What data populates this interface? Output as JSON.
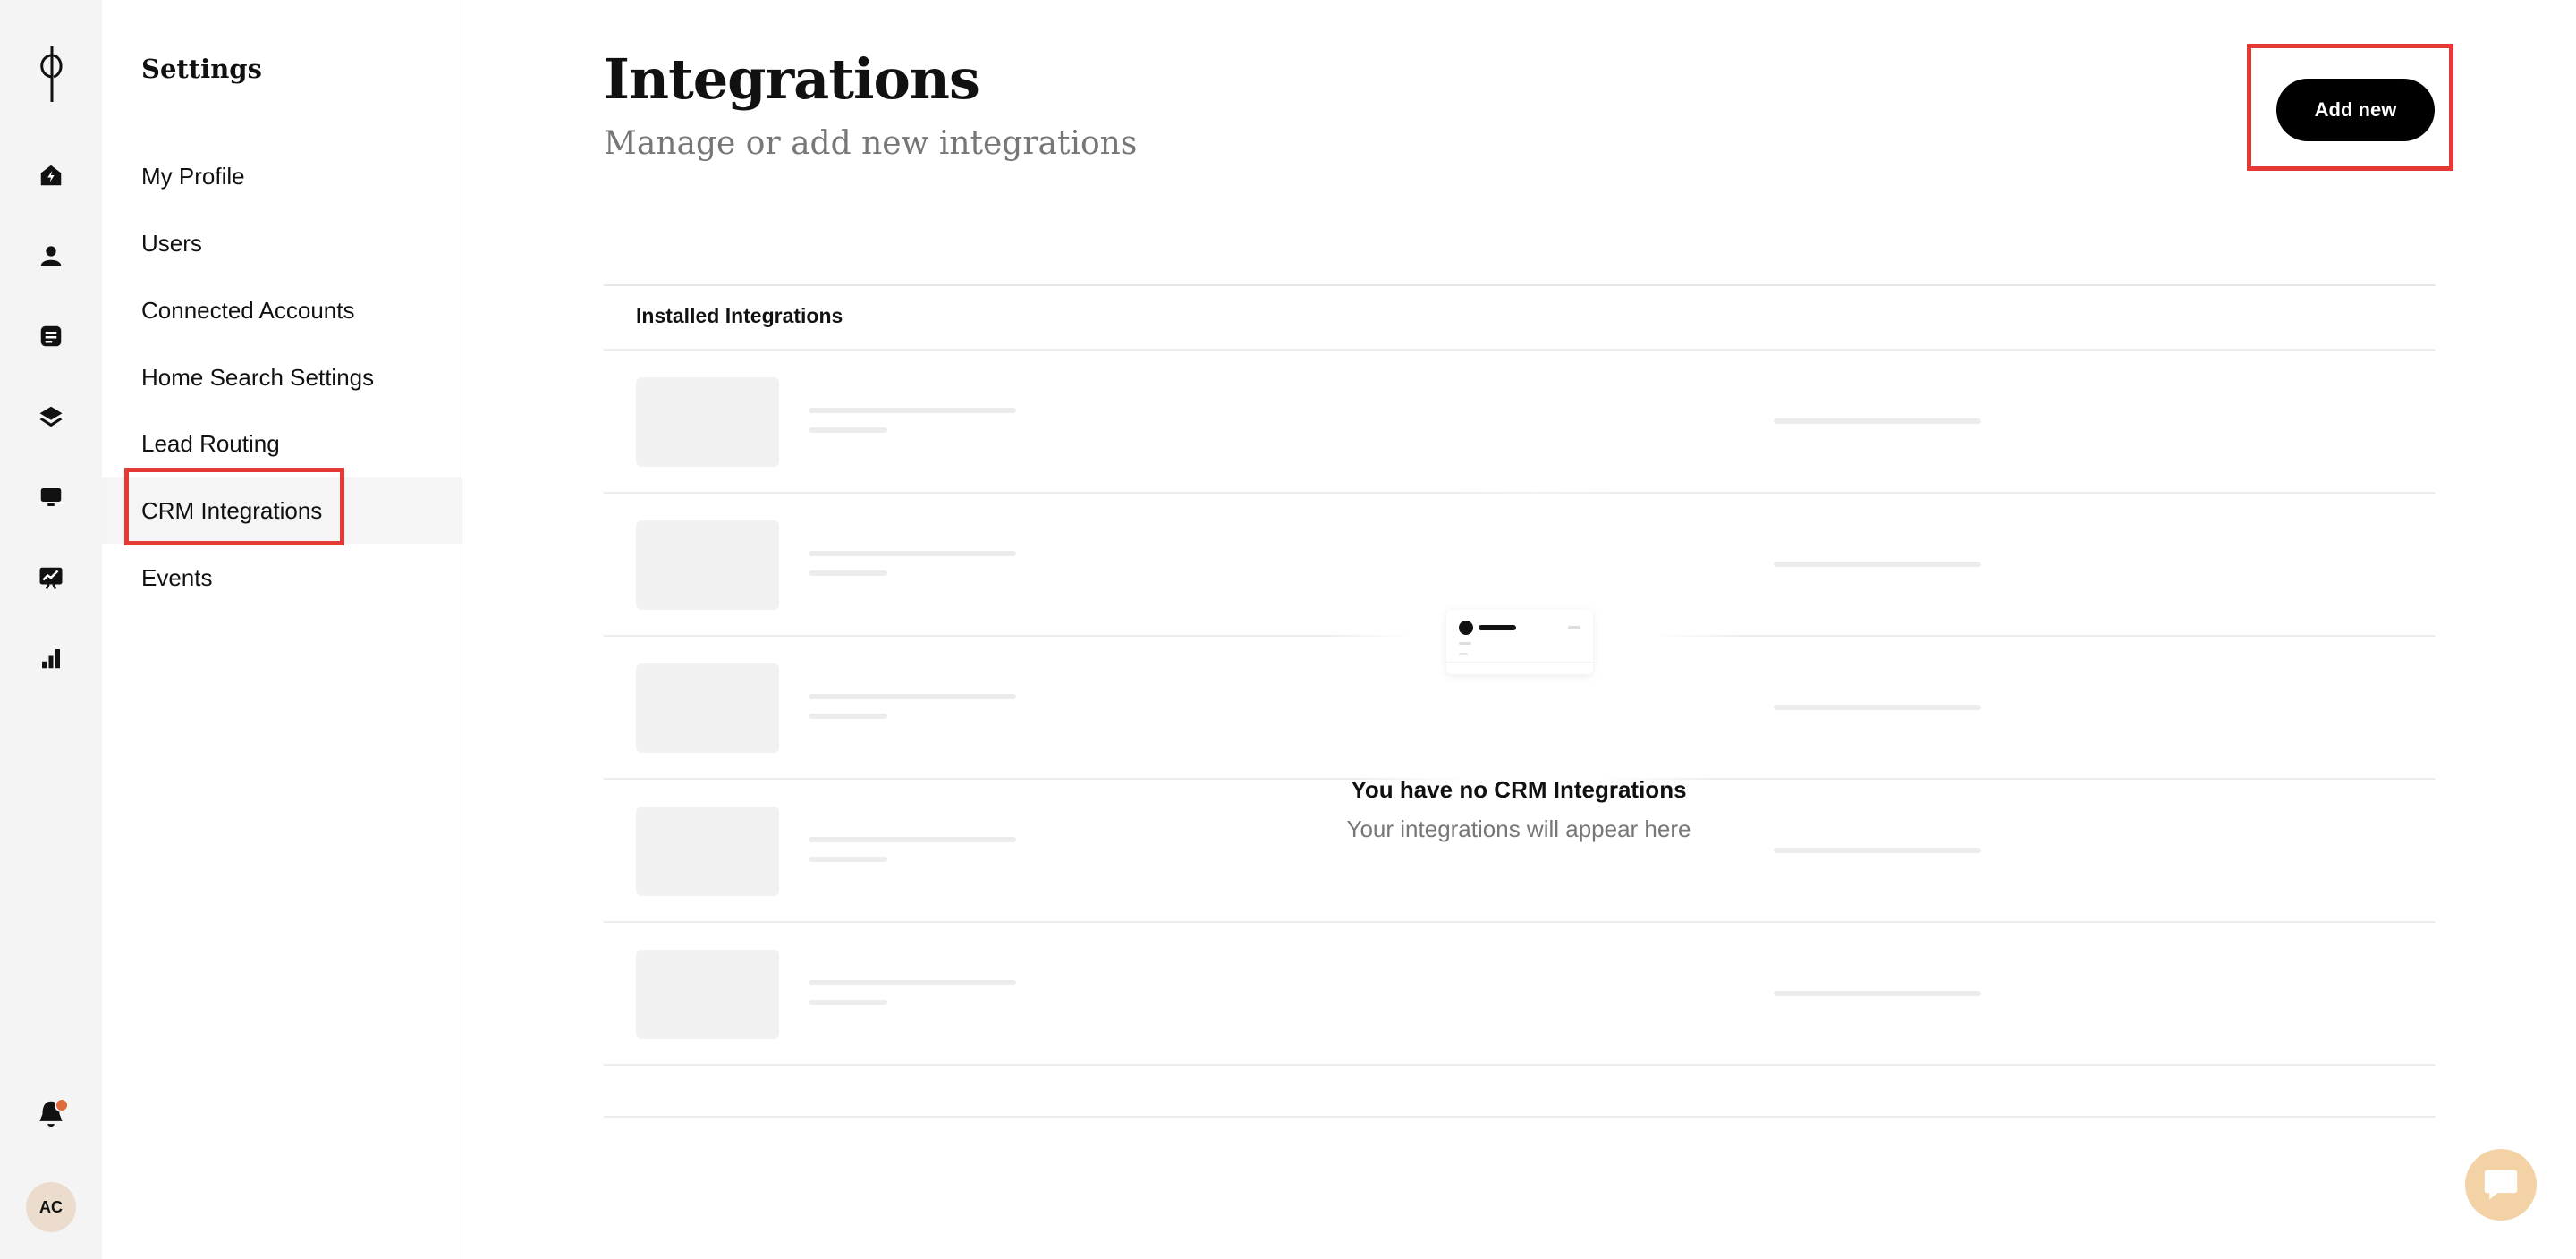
{
  "rail": {
    "logo_icon": "logo-icon",
    "icons": [
      "home-icon",
      "person-icon",
      "document-icon",
      "layers-icon",
      "monitor-icon",
      "chart-presentation-icon",
      "bar-chart-icon"
    ],
    "notification_icon": "bell-icon",
    "avatar_initials": "AC"
  },
  "settings": {
    "title": "Settings",
    "items": [
      {
        "label": "My Profile"
      },
      {
        "label": "Users"
      },
      {
        "label": "Connected Accounts"
      },
      {
        "label": "Home Search Settings"
      },
      {
        "label": "Lead Routing"
      },
      {
        "label": "CRM Integrations",
        "active": true
      },
      {
        "label": "Events"
      }
    ]
  },
  "main": {
    "title": "Integrations",
    "subtitle": "Manage or add new integrations",
    "add_button": "Add new",
    "table_header": "Installed Integrations",
    "empty_title": "You have no CRM Integrations",
    "empty_subtitle": "Your integrations will appear here"
  },
  "colors": {
    "highlight": "#e53935",
    "primary_button": "#000000",
    "chat_bubble": "#f3d3a6",
    "notification_dot": "#e06a3a"
  }
}
